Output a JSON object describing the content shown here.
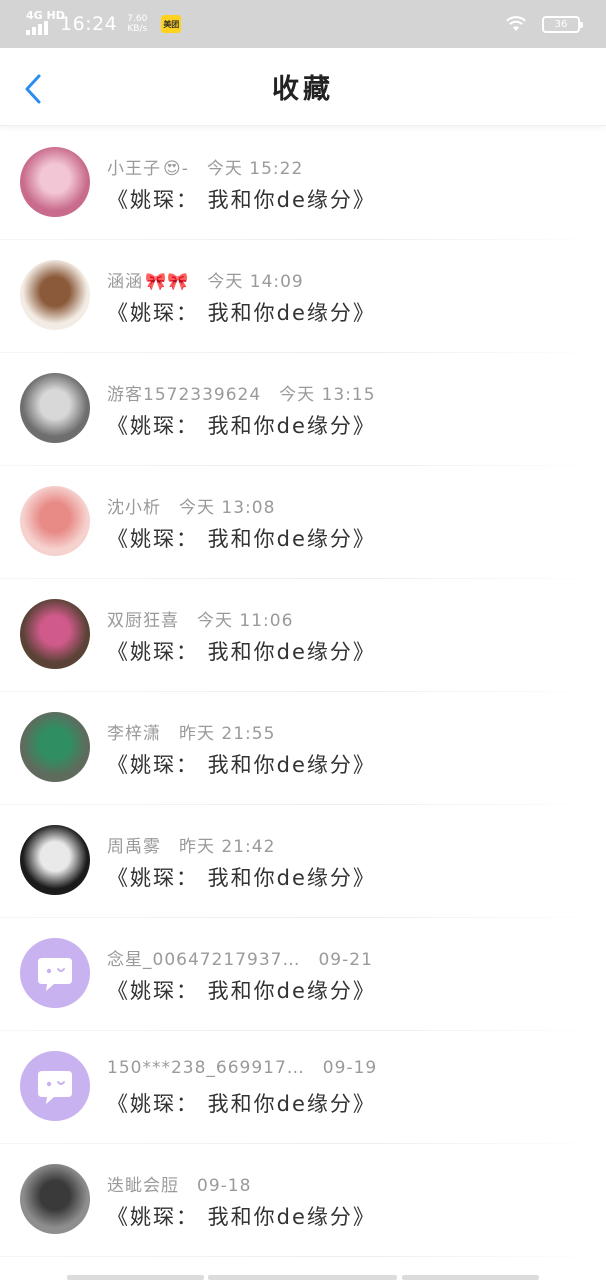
{
  "status_bar": {
    "network": "4G HD",
    "time": "16:24",
    "speed_value": "7.60",
    "speed_unit": "KB/s",
    "app_badge": "美团",
    "battery": "36"
  },
  "header": {
    "title": "收藏"
  },
  "items": [
    {
      "user": "小王子",
      "emoji": "😍",
      "suffix": "-",
      "time": "今天 15:22",
      "title": "《姚琛： 我和你de缘分》",
      "avatar": {
        "bg": "#c86b8c",
        "fg": "#f2c6d4"
      }
    },
    {
      "user": "涵涵",
      "emoji": "🎀🎀",
      "suffix": "",
      "time": "今天 14:09",
      "title": "《姚琛： 我和你de缘分》",
      "avatar": {
        "bg": "#f3ece4",
        "fg": "#8a5a3a"
      }
    },
    {
      "user": "游客1572339624",
      "emoji": "",
      "suffix": "",
      "time": "今天 13:15",
      "title": "《姚琛： 我和你de缘分》",
      "avatar": {
        "bg": "#6e6e6e",
        "fg": "#d8d8d8"
      }
    },
    {
      "user": "沈小析",
      "emoji": "",
      "suffix": "",
      "time": "今天 13:08",
      "title": "《姚琛： 我和你de缘分》",
      "avatar": {
        "bg": "#f6d2cf",
        "fg": "#e88a86"
      }
    },
    {
      "user": "双厨狂喜",
      "emoji": "",
      "suffix": "",
      "time": "今天 11:06",
      "title": "《姚琛： 我和你de缘分》",
      "avatar": {
        "bg": "#5a4236",
        "fg": "#d05a8a"
      }
    },
    {
      "user": "李梓潇",
      "emoji": "",
      "suffix": "",
      "time": "昨天 21:55",
      "title": "《姚琛： 我和你de缘分》",
      "avatar": {
        "bg": "#5f6b5d",
        "fg": "#2f8f63"
      }
    },
    {
      "user": "周禹雾",
      "emoji": "",
      "suffix": "",
      "time": "昨天 21:42",
      "title": "《姚琛： 我和你de缘分》",
      "avatar": {
        "bg": "#1b1b1b",
        "fg": "#e9e9e9"
      }
    },
    {
      "user": "念星_00647217937…",
      "emoji": "",
      "suffix": "",
      "time": "09-21",
      "title": "《姚琛： 我和你de缘分》",
      "avatar": {
        "bg": "#c8b2f0",
        "fg": "#ffffff",
        "kind": "default"
      }
    },
    {
      "user": "150***238_669917…",
      "emoji": "",
      "suffix": "",
      "time": "09-19",
      "title": "《姚琛： 我和你de缘分》",
      "avatar": {
        "bg": "#c8b2f0",
        "fg": "#ffffff",
        "kind": "default"
      }
    },
    {
      "user": "迭眦会脰",
      "emoji": "",
      "suffix": "",
      "time": "09-18",
      "title": "《姚琛： 我和你de缘分》",
      "avatar": {
        "bg": "#8e8e8e",
        "fg": "#3a3a3a"
      }
    }
  ]
}
